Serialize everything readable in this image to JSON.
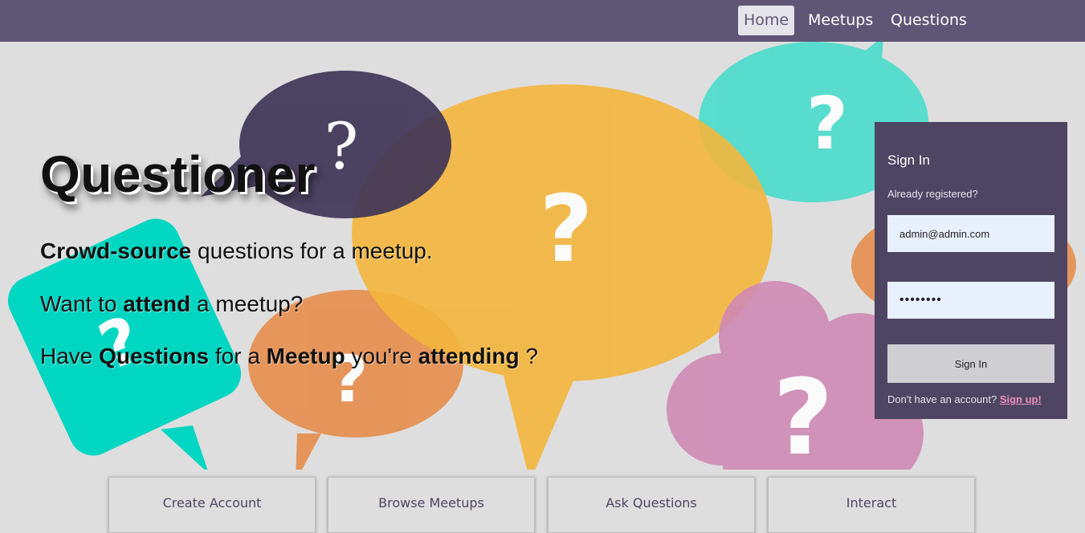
{
  "nav": {
    "items": [
      {
        "label": "Home",
        "active": true
      },
      {
        "label": "Meetups",
        "active": false
      },
      {
        "label": "Questions",
        "active": false
      }
    ]
  },
  "hero": {
    "title": "Questioner",
    "tagline1": {
      "bold": "Crowd-source",
      "rest": " questions for a meetup."
    },
    "tagline2": {
      "pre": "Want to ",
      "bold": "attend",
      "rest": " a meetup?"
    },
    "tagline3": {
      "pre": "Have ",
      "bold1": "Questions",
      "mid": " for a ",
      "bold2": "Meetup",
      "mid2": " you're ",
      "bold3": "attending",
      "rest": " ?"
    },
    "bubble_glyph": "?"
  },
  "signin": {
    "title": "Sign In",
    "subtitle": "Already registered?",
    "email_value": "admin@admin.com",
    "password_value": "••••••••",
    "button_label": "Sign In",
    "signup_prompt": "Don't have an account? ",
    "signup_link": "Sign up!"
  },
  "features": [
    {
      "label": "Create Account"
    },
    {
      "label": "Browse Meetups"
    },
    {
      "label": "Ask Questions"
    },
    {
      "label": "Interact"
    }
  ],
  "colors": {
    "nav": "#5f5676",
    "panel": "#4e4562",
    "bubble_dark": "#3f3557",
    "bubble_yellow": "#f4b63d",
    "bubble_teal": "#4cdccc",
    "bubble_orange": "#e68e4f",
    "bubble_pink": "#cf8ab4"
  }
}
